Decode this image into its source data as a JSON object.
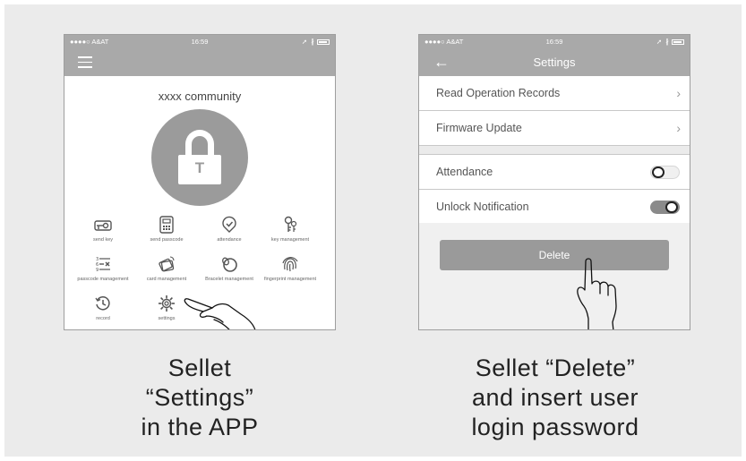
{
  "left_phone": {
    "status": {
      "carrier": "●●●●○ A&AT",
      "time": "16:59",
      "right_icons": "➚ ∦"
    },
    "community": "xxxx community",
    "grid": [
      {
        "label": "send key",
        "icon": "key-card-icon"
      },
      {
        "label": "send passcode",
        "icon": "keypad-icon"
      },
      {
        "label": "attendance",
        "icon": "check-badge-icon"
      },
      {
        "label": "key management",
        "icon": "keys-icon"
      },
      {
        "label": "passcode management",
        "icon": "passcode-list-icon"
      },
      {
        "label": "card management",
        "icon": "cards-icon"
      },
      {
        "label": "Bracelet management",
        "icon": "bracelet-icon"
      },
      {
        "label": "fingerprint management",
        "icon": "fingerprint-icon"
      },
      {
        "label": "record",
        "icon": "history-icon"
      },
      {
        "label": "settings",
        "icon": "gear-icon"
      }
    ]
  },
  "right_phone": {
    "status": {
      "carrier": "●●●●○ A&AT",
      "time": "16:59",
      "right_icons": "➚ ∦"
    },
    "title": "Settings",
    "rows": {
      "read_records": "Read Operation Records",
      "firmware": "Firmware Update",
      "attendance": "Attendance",
      "unlock_notification": "Unlock Notification"
    },
    "toggles": {
      "attendance": "off",
      "unlock_notification": "on"
    },
    "delete_label": "Delete"
  },
  "captions": {
    "left": [
      "Sellet",
      "“Settings”",
      "in the APP"
    ],
    "right": [
      "Sellet “Delete”",
      "and insert user",
      "login password"
    ]
  },
  "colors": {
    "bar": "#a9a9a9",
    "background": "#ebebeb",
    "button": "#9a9a9a"
  }
}
